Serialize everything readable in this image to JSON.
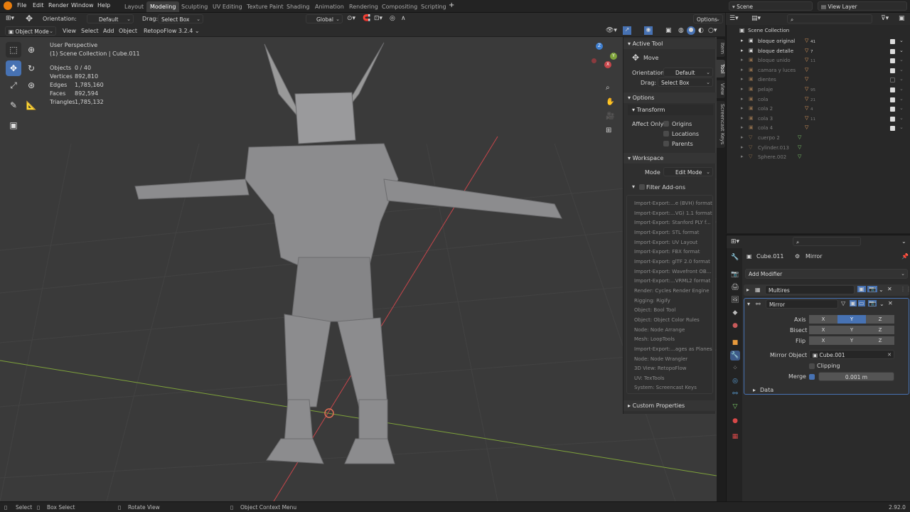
{
  "topbar": {
    "menus": [
      "File",
      "Edit",
      "Render",
      "Window",
      "Help"
    ],
    "workspaces": [
      "Layout",
      "Modeling",
      "Sculpting",
      "UV Editing",
      "Texture Paint",
      "Shading",
      "Animation",
      "Rendering",
      "Compositing",
      "Scripting"
    ],
    "active_workspace": "Modeling",
    "scene": "Scene",
    "view_layer": "View Layer"
  },
  "header2": {
    "orientation_label": "Orientation:",
    "orientation_value": "Default",
    "drag_label": "Drag:",
    "drag_value": "Select Box",
    "transform_space": "Global",
    "options": "Options"
  },
  "header3": {
    "mode": "Object Mode",
    "menus": [
      "View",
      "Select",
      "Add",
      "Object"
    ],
    "addon": "RetopoFlow 3.2.4"
  },
  "viewport": {
    "perspective": "User Perspective",
    "collection": "(1) Scene Collection | Cube.011",
    "stats": [
      {
        "label": "Objects",
        "value": "0 / 40"
      },
      {
        "label": "Vertices",
        "value": "892,810"
      },
      {
        "label": "Edges",
        "value": "1,785,160"
      },
      {
        "label": "Faces",
        "value": "892,594"
      },
      {
        "label": "Triangles",
        "value": "1,785,132"
      }
    ],
    "gizmo": {
      "x": "X",
      "y": "Y",
      "z": "Z"
    }
  },
  "npanel": {
    "active_tool": "Active Tool",
    "move": "Move",
    "orientation_label": "Orientation",
    "orientation_value": "Default",
    "drag_label": "Drag:",
    "drag_value": "Select Box",
    "options": "Options",
    "transform": "Transform",
    "affect_only": "Affect Only",
    "origins": "Origins",
    "locations": "Locations",
    "parents": "Parents",
    "workspace": "Workspace",
    "mode_label": "Mode",
    "mode_value": "Edit Mode",
    "filter_addons": "Filter Add-ons",
    "addons": [
      "Import-Export:...e (BVH) format",
      "Import-Export:...VG) 1.1 format",
      "Import-Export: Stanford PLY f...",
      "Import-Export: STL format",
      "Import-Export: UV Layout",
      "Import-Export: FBX format",
      "Import-Export: glTF 2.0 format",
      "Import-Export: Wavefront OB...",
      "Import-Export:...VRML2 format",
      "Render: Cycles Render Engine",
      "Rigging: Rigify",
      "Object: Bool Tool",
      "Object: Object Color Rules",
      "Node: Node Arrange",
      "Mesh: LoopTools",
      "Import-Export:...ages as Planes",
      "Node: Node Wrangler",
      "3D View: RetopoFlow",
      "UV: TexTools",
      "System: Screencast Keys"
    ],
    "custom_properties": "Custom Properties",
    "side_tabs": [
      "Item",
      "Tool",
      "View",
      "Screencast Keys"
    ]
  },
  "outliner": {
    "root": "Scene Collection",
    "items": [
      {
        "name": "bloque original",
        "badge": "41",
        "checked": true,
        "dim": false
      },
      {
        "name": "bloque detalle",
        "badge": "7",
        "checked": true,
        "dim": false
      },
      {
        "name": "bloque unido",
        "badge": "11",
        "checked": true,
        "dim": true
      },
      {
        "name": "camara y luces",
        "badge": "",
        "checked": true,
        "dim": true
      },
      {
        "name": "dientes",
        "badge": "",
        "checked": false,
        "dim": true
      },
      {
        "name": "pelaje",
        "badge": "95",
        "checked": true,
        "dim": true
      },
      {
        "name": "cola",
        "badge": "21",
        "checked": true,
        "dim": true
      },
      {
        "name": "cola 2",
        "badge": "4",
        "checked": true,
        "dim": true
      },
      {
        "name": "cola 3",
        "badge": "11",
        "checked": true,
        "dim": true
      },
      {
        "name": "cola 4",
        "badge": "",
        "checked": true,
        "dim": true
      },
      {
        "name": "cuerpo 2",
        "badge": "",
        "checked": false,
        "dim": true
      },
      {
        "name": "Cylinder.013",
        "badge": "",
        "checked": false,
        "dim": true
      },
      {
        "name": "Sphere.002",
        "badge": "",
        "checked": false,
        "dim": true
      }
    ]
  },
  "properties": {
    "object": "Cube.011",
    "modifier_crumb": "Mirror",
    "add_modifier": "Add Modifier",
    "modifiers": [
      "Multires",
      "Mirror"
    ],
    "axis_label": "Axis",
    "bisect_label": "Bisect",
    "flip_label": "Flip",
    "x": "X",
    "y": "Y",
    "z": "Z",
    "mirror_object_label": "Mirror Object",
    "mirror_object_value": "Cube.001",
    "clipping": "Clipping",
    "merge_label": "Merge",
    "merge_value": "0.001 m",
    "data": "Data"
  },
  "statusbar": {
    "select": "Select",
    "box_select": "Box Select",
    "rotate_view": "Rotate View",
    "context_menu": "Object Context Menu",
    "version": "2.92.0"
  },
  "colors": {
    "accent": "#4772b3",
    "viewport_bg": "#3b3b3b",
    "x_axis": "#c8464b",
    "y_axis": "#7fa33b",
    "z_axis": "#3f7fd0"
  }
}
